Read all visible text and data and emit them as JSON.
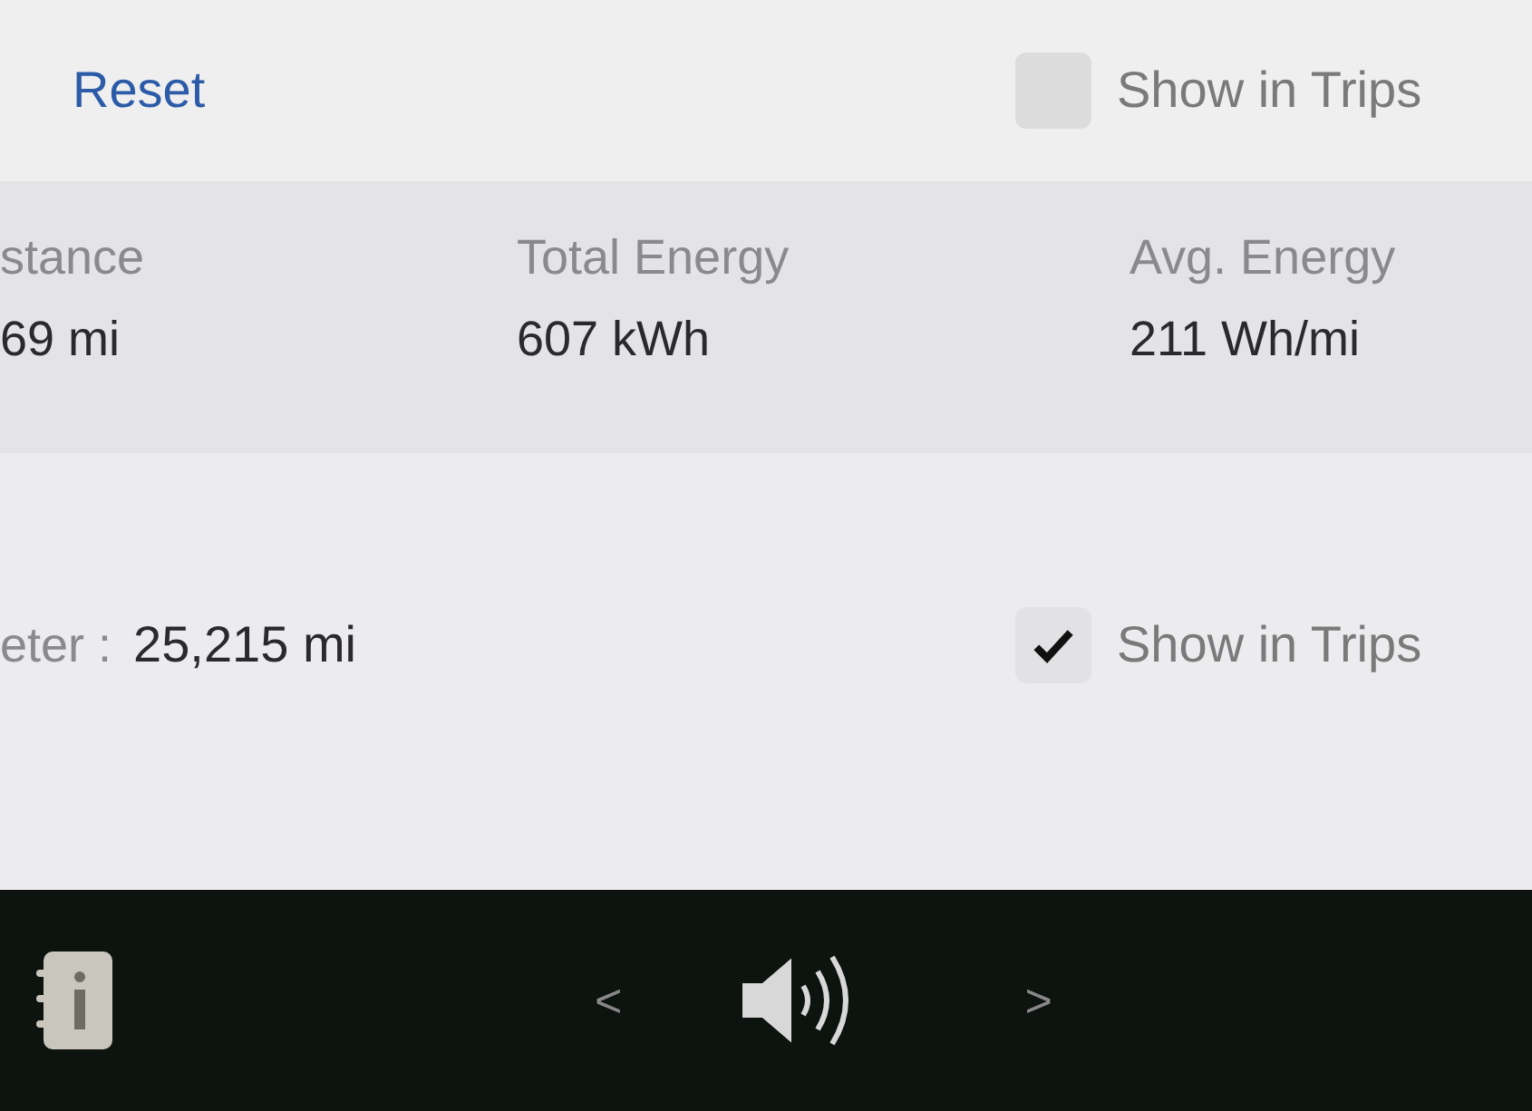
{
  "header": {
    "reset_link": "Reset",
    "show_in_trips": {
      "label": "Show in Trips",
      "checked": false
    }
  },
  "stats": [
    {
      "label": "stance",
      "value": "69 mi"
    },
    {
      "label": "Total Energy",
      "value": "607 kWh"
    },
    {
      "label": "Avg. Energy",
      "value": "211 Wh/mi"
    }
  ],
  "odometer": {
    "label": "eter :",
    "value": "25,215 mi"
  },
  "show_in_trips": {
    "label": "Show in Trips",
    "checked": true
  },
  "bottom_bar": {
    "prev": "<",
    "next": ">"
  }
}
